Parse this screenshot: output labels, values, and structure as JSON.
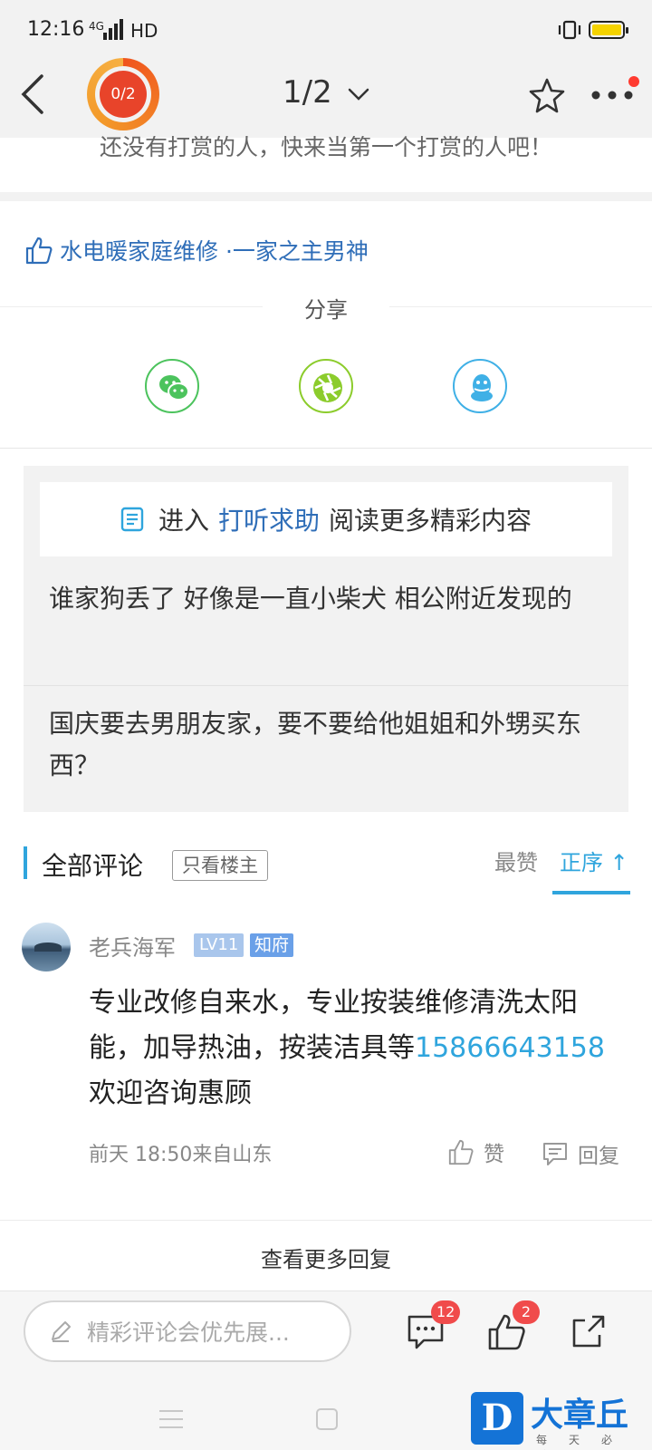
{
  "status_bar": {
    "time": "12:16",
    "signal": "4G",
    "network": "HD",
    "battery_level": 0.7,
    "battery_color": "#f5d300"
  },
  "header": {
    "reward_progress": "0/2",
    "pages": "1/2",
    "accent_color": "#f0541e",
    "icons": [
      "back-icon",
      "chevron-down-icon",
      "star-icon",
      "more-icon"
    ]
  },
  "reward": {
    "text": "还没有打赏的人，快来当第一个打赏的人吧！"
  },
  "topic": {
    "text": "水电暖家庭维修 ·一家之主男神"
  },
  "share": {
    "title": "分享",
    "icons": [
      "wechat-icon",
      "moments-icon",
      "qq-icon"
    ]
  },
  "related": {
    "prefix": "进入",
    "link": "打听求助",
    "suffix": "阅读更多精彩内容",
    "items": [
      "谁家狗丢了 好像是一直小柴犬 相公附近发现的",
      "国庆要去男朋友家，要不要给他姐姐和外甥买东西？"
    ]
  },
  "comments": {
    "title": "全部评论",
    "filter": "只看楼主",
    "sort_hot": "最赞",
    "sort_asc": "正序",
    "sort_asc_arrow": "↑",
    "accent_color": "#2fa5dd",
    "items": [
      {
        "user": "老兵海军",
        "level": "LV11",
        "badge": "知府",
        "body_before": "专业改修自来水，专业按装维修清洗太阳能，加导热油，按装洁具等",
        "phone": "15866643158",
        "body_after": "欢迎咨询惠顾",
        "meta": "前天 18:50来自山东",
        "like_label": "赞",
        "reply_label": "回复"
      }
    ],
    "more": "查看更多回复"
  },
  "bottom_bar": {
    "placeholder": "精彩评论会优先展...",
    "comment_count": "12",
    "like_count": "2"
  },
  "watermark": {
    "logo": "D",
    "name": "大章丘",
    "sub": "每天必看"
  }
}
